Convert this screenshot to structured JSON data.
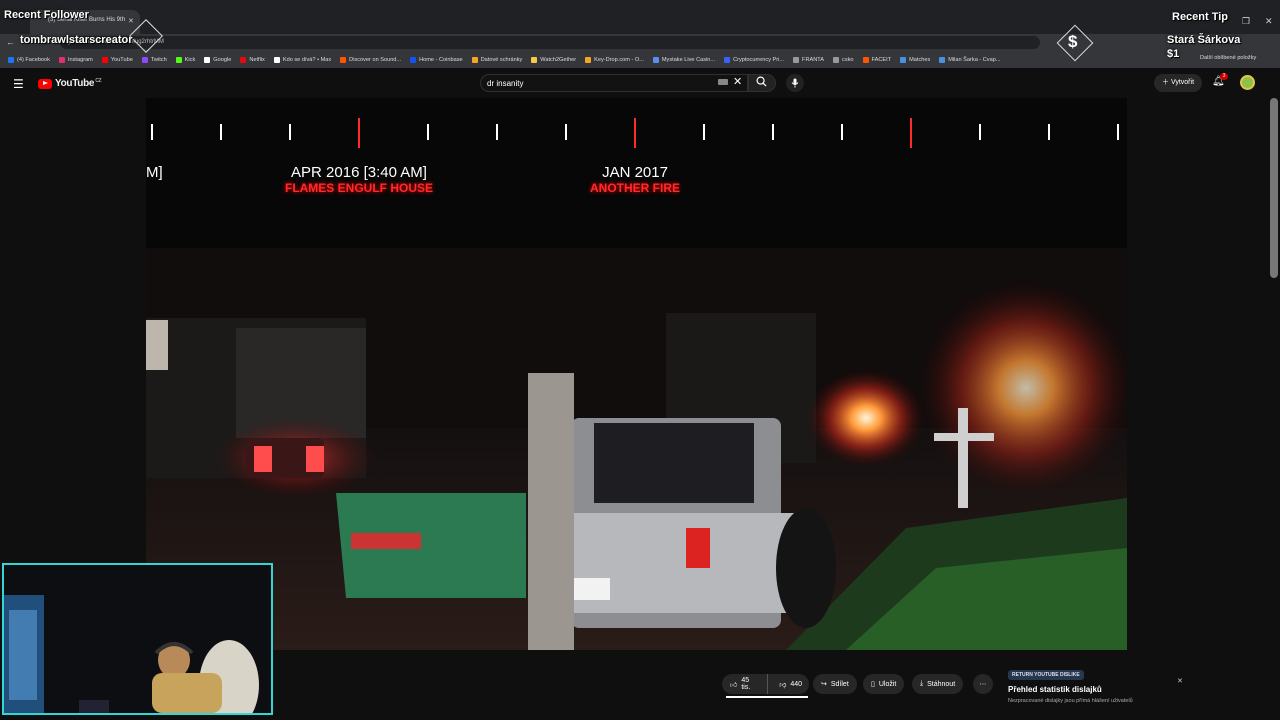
{
  "browser": {
    "tab_title": "(3) Serial Killer Burns His 9th",
    "url": "youtube.com/watch?v=Slug2rhtrMM",
    "bookmarks": [
      {
        "label": "(4) Facebook",
        "color": "#1877f2"
      },
      {
        "label": "Instagram",
        "color": "#e1306c"
      },
      {
        "label": "YouTube",
        "color": "#ff0000"
      },
      {
        "label": "Twitch",
        "color": "#9146ff"
      },
      {
        "label": "Kick",
        "color": "#53fc18"
      },
      {
        "label": "Google",
        "color": "#ffffff"
      },
      {
        "label": "Netflix",
        "color": "#e50914"
      },
      {
        "label": "Kdo se dívá? • Max",
        "color": "#ffffff"
      },
      {
        "label": "Discover on Sound...",
        "color": "#ff5500"
      },
      {
        "label": "Home - Coinbase",
        "color": "#1652f0"
      },
      {
        "label": "Datové schránky",
        "color": "#f5a623"
      },
      {
        "label": "Watch2Gether",
        "color": "#f7c948"
      },
      {
        "label": "Key-Drop.com - O...",
        "color": "#f5a623"
      },
      {
        "label": "Mystake Live Casin...",
        "color": "#5b8def"
      },
      {
        "label": "Cryptocurrency Pri...",
        "color": "#3861fb"
      },
      {
        "label": "FRANTA",
        "color": "#999999"
      },
      {
        "label": "csko",
        "color": "#999999"
      },
      {
        "label": "FACEIT",
        "color": "#ff5500"
      },
      {
        "label": "Matches",
        "color": "#4a90e2"
      },
      {
        "label": "Milan Šarka - Cvap...",
        "color": "#4a90e2"
      }
    ],
    "other_bookmarks": "Další oblíbené položky"
  },
  "youtube": {
    "logo_text": "YouTube",
    "region": "CZ",
    "search_value": "dr insanity",
    "create_label": "Vytvořit",
    "notification_count": "3"
  },
  "video": {
    "timeline": [
      {
        "date": "APR 2016 [3:40 AM]",
        "event": "FLAMES ENGULF HOUSE"
      },
      {
        "date": "JAN 2017",
        "event": "ANOTHER FIRE"
      }
    ],
    "edge_fragment": "M]"
  },
  "actions": {
    "likes": "45 tis.",
    "dislikes": "440",
    "share": "Sdílet",
    "save": "Uložit",
    "download": "Stáhnout",
    "more": "⋯"
  },
  "ryd": {
    "badge": "RETURN YOUTUBE DISLIKE",
    "title": "Přehled statistik dislajků",
    "subtitle": "Nezpracované dislajky jsou přímá hlášení uživatelů"
  },
  "overlay": {
    "recent_follower_label": "Recent Follower",
    "recent_follower_name": "tombrawlstarscreator",
    "recent_tip_label": "Recent Tip",
    "recent_tip_name": "Stará Šárkova",
    "recent_tip_amount": "$1"
  },
  "colors": {
    "accent_red": "#ff2a2a",
    "webcam_border": "#36d4d4",
    "youtube_red": "#ff0000"
  }
}
